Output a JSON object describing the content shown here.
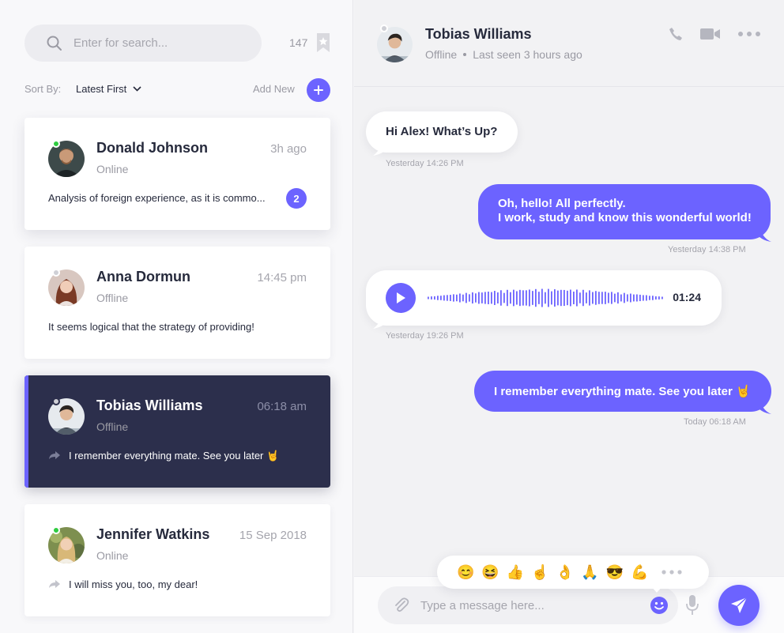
{
  "sidebar": {
    "search": {
      "placeholder": "Enter for search..."
    },
    "count": "147",
    "sort": {
      "label": "Sort By:",
      "value": "Latest First"
    },
    "add_new": "Add New",
    "contacts": [
      {
        "name": "Donald Johnson",
        "status": "Online",
        "time": "3h ago",
        "preview": "Analysis of foreign experience, as it is commo...",
        "unread": "2"
      },
      {
        "name": "Anna Dormun",
        "status": "Offline",
        "time": "14:45 pm",
        "preview": "It seems logical that the strategy of providing!"
      },
      {
        "name": "Tobias Williams",
        "status": "Offline",
        "time": "06:18 am",
        "preview": "I remember everything mate. See you later 🤘"
      },
      {
        "name": "Jennifer Watkins",
        "status": "Online",
        "time": "15 Sep 2018",
        "preview": "I will miss you, too, my dear!"
      }
    ]
  },
  "chat": {
    "header": {
      "name": "Tobias Williams",
      "status": "Offline",
      "last_seen": "Last seen 3 hours ago"
    },
    "messages": [
      {
        "text": "Hi Alex! What’s Up?",
        "time": "Yesterday 14:26 PM"
      },
      {
        "line1": "Oh, hello! All perfectly.",
        "line2": "I work, study and know this wonderful world!",
        "time": "Yesterday 14:38 PM"
      },
      {
        "duration": "01:24",
        "time": "Yesterday 19:26 PM"
      },
      {
        "text": "I remember everything mate. See you later 🤘",
        "time": "Today 06:18 AM"
      }
    ],
    "emojis": [
      "😊",
      "😆",
      "👍",
      "☝️",
      "👌",
      "🙏",
      "😎",
      "💪"
    ],
    "composer": {
      "placeholder": "Type a message here..."
    }
  },
  "colors": {
    "accent": "#6c63ff",
    "online": "#2ecc40",
    "active_card": "#2c2f4c"
  }
}
